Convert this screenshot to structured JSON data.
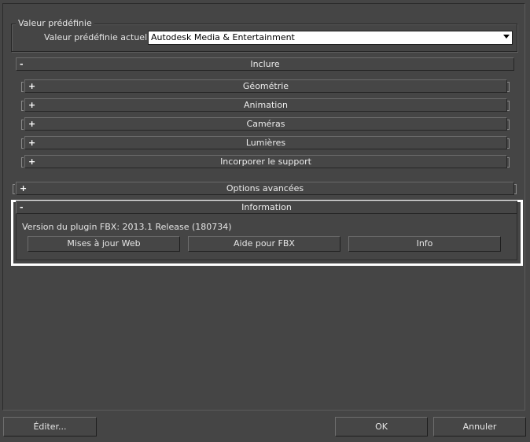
{
  "preset_group": {
    "title": "Valeur prédéfinie",
    "current_label": "Valeur prédéfinie actuelle:",
    "current_value": "Autodesk Media & Entertainment"
  },
  "rollouts": {
    "include": {
      "sign": "-",
      "label": "Inclure"
    },
    "geometry": {
      "sign": "+",
      "label": "Géométrie"
    },
    "animation": {
      "sign": "+",
      "label": "Animation"
    },
    "cameras": {
      "sign": "+",
      "label": "Caméras"
    },
    "lights": {
      "sign": "+",
      "label": "Lumières"
    },
    "embed_media": {
      "sign": "+",
      "label": "Incorporer le support"
    },
    "advanced": {
      "sign": "+",
      "label": "Options avancées"
    },
    "information": {
      "sign": "-",
      "label": "Information"
    }
  },
  "information": {
    "version_text": "Version du plugin FBX: 2013.1 Release (180734)",
    "web_updates": "Mises à jour Web",
    "fbx_help": "Aide pour FBX",
    "info": "Info"
  },
  "footer": {
    "edit": "Éditer...",
    "ok": "OK",
    "cancel": "Annuler"
  },
  "colors": {
    "background": "#454545",
    "highlight_border": "#ffffff",
    "dropdown_bg": "#ffffff"
  }
}
